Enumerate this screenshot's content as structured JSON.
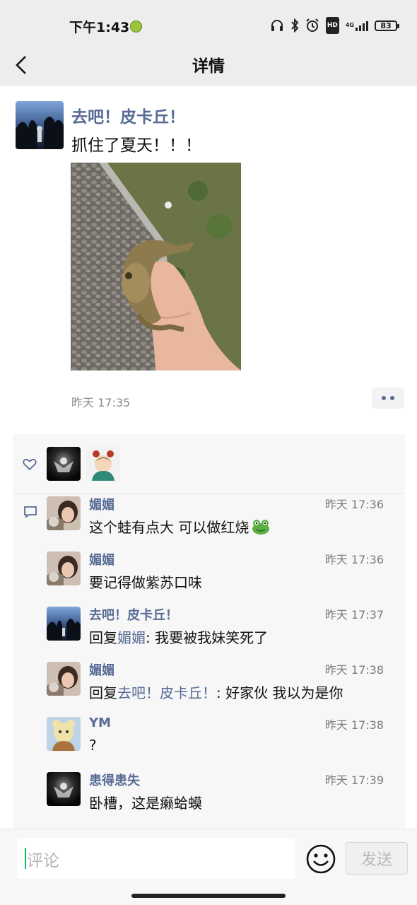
{
  "status_bar": {
    "time": "下午1:43",
    "network": "4G",
    "battery": "83"
  },
  "nav": {
    "title": "详情"
  },
  "post": {
    "author": "去吧！皮卡丘！",
    "text": "抓住了夏天！！！",
    "time": "昨天 17:35"
  },
  "comments": [
    {
      "name": "媚媚",
      "time": "昨天 17:36",
      "text": "这个蛙有点大   可以做红烧",
      "emoji": "frog-emoji"
    },
    {
      "name": "媚媚",
      "time": "昨天 17:36",
      "text": "要记得做紫苏口味"
    },
    {
      "name": "去吧！皮卡丘！",
      "time": "昨天 17:37",
      "reply_prefix": "回复",
      "reply_to": "媚媚",
      "text": ": 我要被我妹笑死了"
    },
    {
      "name": "媚媚",
      "time": "昨天 17:38",
      "reply_prefix": "回复",
      "reply_to": "去吧！皮卡丘！",
      "text": ": 好家伙 我以为是你"
    },
    {
      "name": "YM",
      "time": "昨天 17:38",
      "text": "?"
    },
    {
      "name": "患得患失",
      "time": "昨天 17:39",
      "text": "卧槽，这是癞蛤蟆"
    }
  ],
  "input": {
    "placeholder": "评论",
    "send_label": "发送"
  },
  "colors": {
    "link_blue": "#576b95",
    "background_gray": "#ededed",
    "panel": "#f7f7f7"
  }
}
